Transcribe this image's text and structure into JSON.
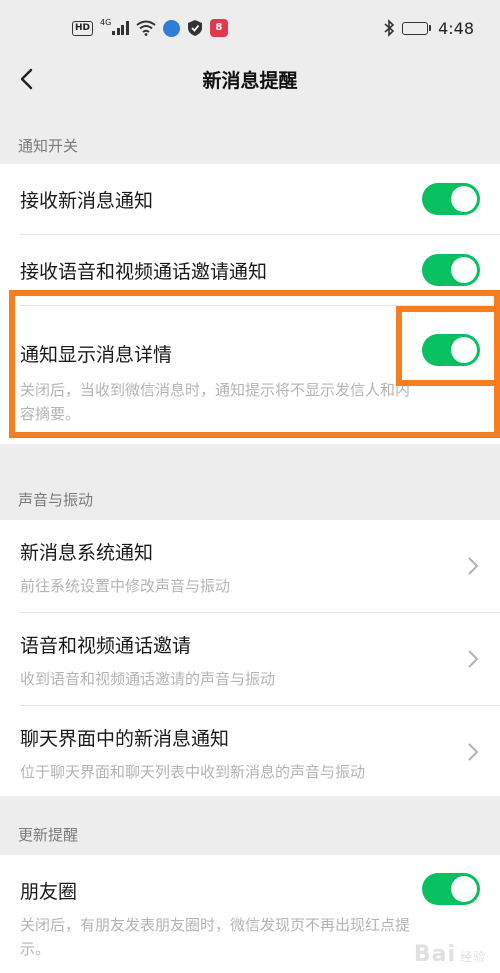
{
  "status_bar": {
    "hd": "HD",
    "network": "4G",
    "app_badge": "8",
    "time": "4:48",
    "battery_level": 0.45
  },
  "nav": {
    "title": "新消息提醒"
  },
  "sections": {
    "notify_switch": {
      "header": "通知开关",
      "receive_new_msg": {
        "title": "接收新消息通知",
        "enabled": true
      },
      "receive_call_invite": {
        "title": "接收语音和视频通话邀请通知",
        "enabled": true
      },
      "show_detail": {
        "title": "通知显示消息详情",
        "enabled": true,
        "desc_line1": "关闭后，当收到微信消息时，通知提示将不显示发信人和内",
        "desc_line2": "容摘要。"
      }
    },
    "sound_vibration": {
      "header": "声音与振动",
      "system_notify": {
        "title": "新消息系统通知",
        "desc": "前往系统设置中修改声音与振动"
      },
      "call_invite": {
        "title": "语音和视频通话邀请",
        "desc": "收到语音和视频通话邀请的声音与振动"
      },
      "chat_notify": {
        "title": "聊天界面中的新消息通知",
        "desc": "位于聊天界面和聊天列表中收到新消息的声音与振动"
      }
    },
    "updates": {
      "header": "更新提醒",
      "moments": {
        "title": "朋友圈",
        "enabled": true,
        "desc_line1": "关闭后，有朋友发表朋友圈时，微信发现页不再出现红点提",
        "desc_line2": "示。"
      }
    }
  },
  "watermark": {
    "text": "Bai",
    "sub": "经验"
  },
  "colors": {
    "toggle_on": "#07c160",
    "highlight": "#f57f20",
    "background": "#ededed"
  }
}
